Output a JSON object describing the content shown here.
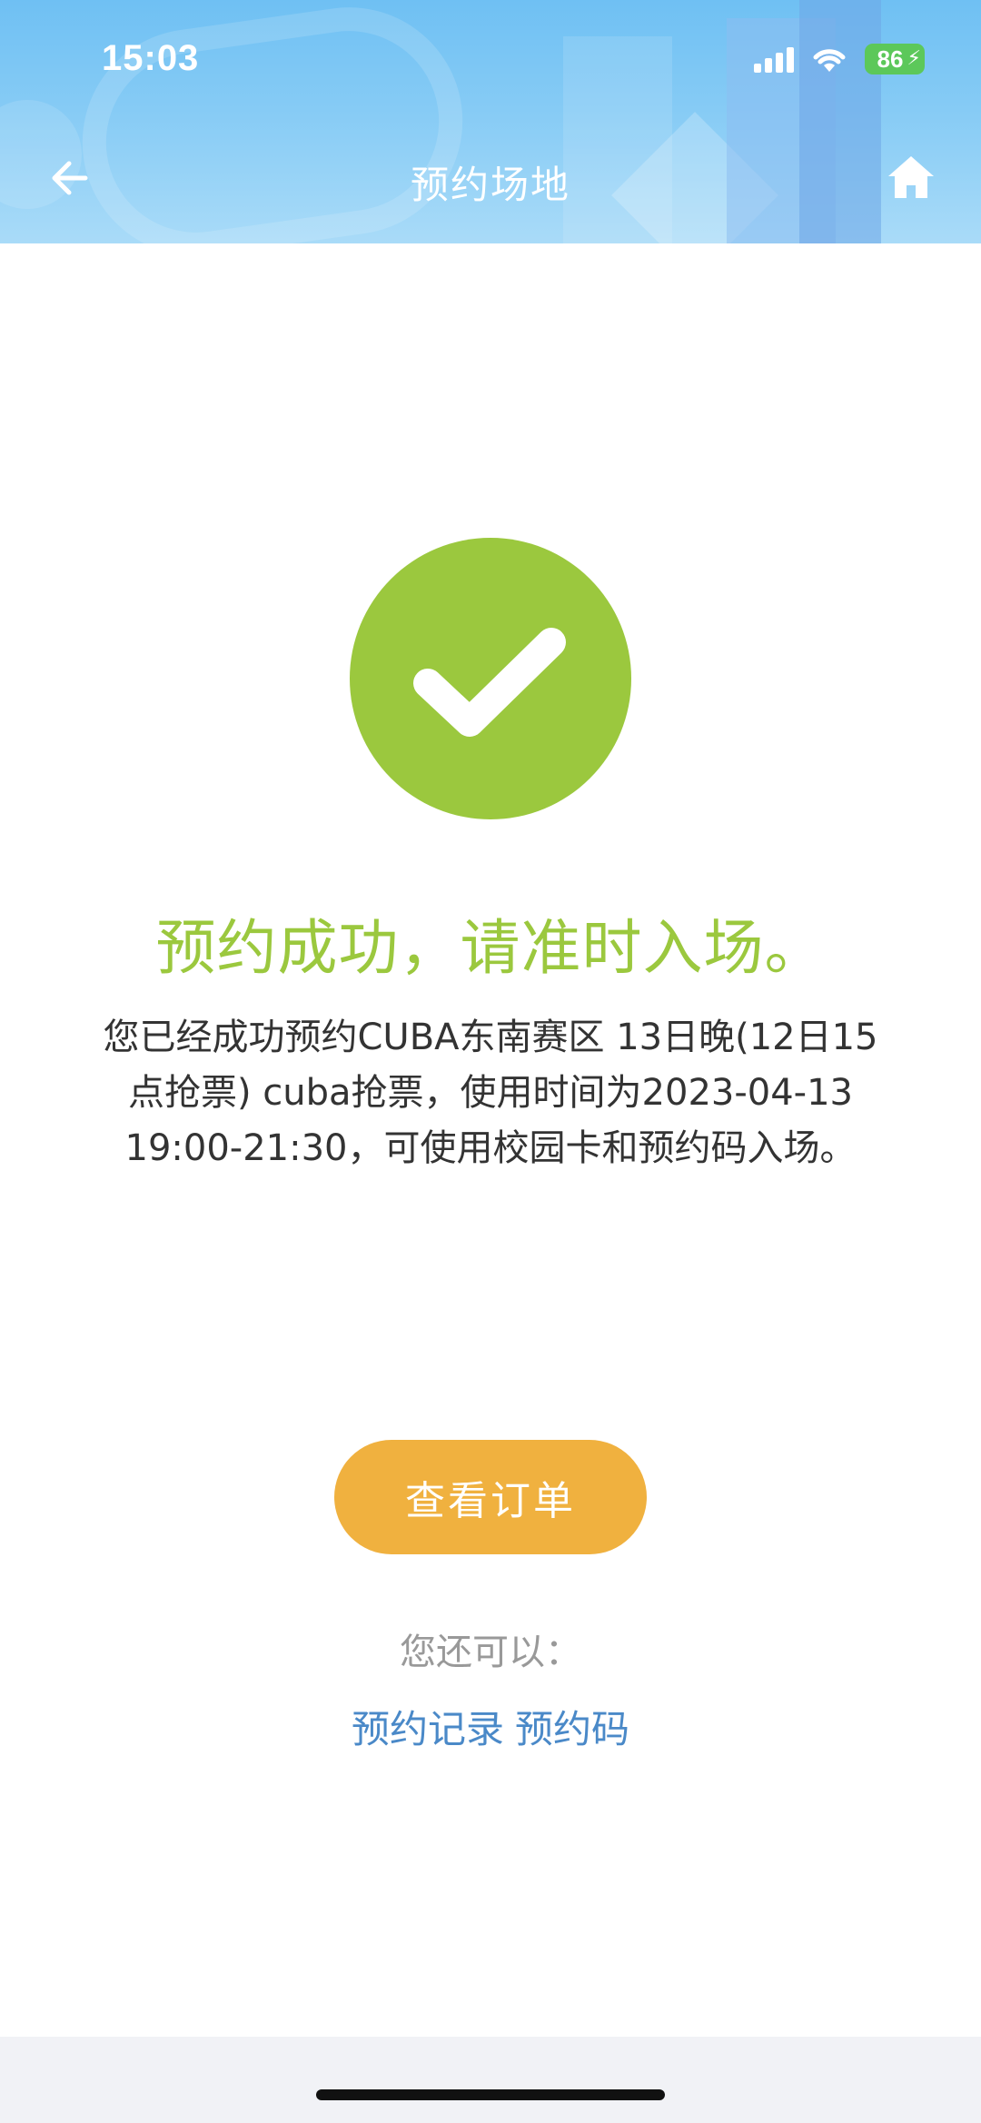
{
  "status_bar": {
    "time": "15:03",
    "battery": "86"
  },
  "nav": {
    "title": "预约场地",
    "back_icon": "arrow-left-icon",
    "home_icon": "home-icon"
  },
  "result": {
    "icon": "check-circle-icon",
    "title": "预约成功，请准时入场。",
    "message": "您已经成功预约CUBA东南赛区 13日晚(12日15点抢票) cuba抢票，使用时间为2023-04-13 19:00-21:30，可使用校园卡和预约码入场。"
  },
  "actions": {
    "view_order_label": "查看订单",
    "also_label": "您还可以：",
    "links": [
      "预约记录",
      "预约码"
    ]
  },
  "colors": {
    "header": "#7ec6f4",
    "success_green": "#9bc83e",
    "button_orange": "#f0b13f",
    "link_blue": "#4a89c8"
  }
}
